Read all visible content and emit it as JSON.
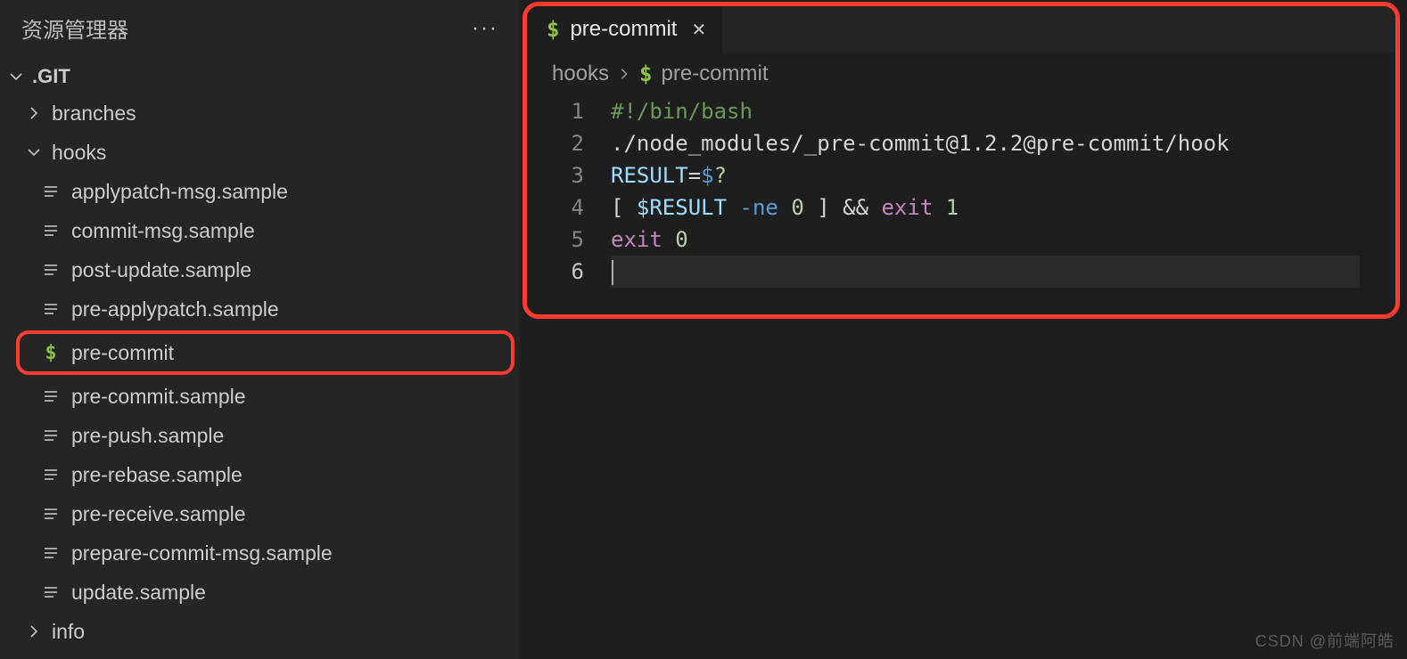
{
  "explorer": {
    "title": "资源管理器",
    "root": ".GIT",
    "folders": [
      {
        "name": "branches",
        "expanded": false
      },
      {
        "name": "hooks",
        "expanded": true
      },
      {
        "name": "info",
        "expanded": false
      }
    ],
    "hooks_files": [
      {
        "name": "applypatch-msg.sample",
        "icon": "lines",
        "highlight": false
      },
      {
        "name": "commit-msg.sample",
        "icon": "lines",
        "highlight": false
      },
      {
        "name": "post-update.sample",
        "icon": "lines",
        "highlight": false
      },
      {
        "name": "pre-applypatch.sample",
        "icon": "lines",
        "highlight": false
      },
      {
        "name": "pre-commit",
        "icon": "dollar",
        "highlight": true
      },
      {
        "name": "pre-commit.sample",
        "icon": "lines",
        "highlight": false
      },
      {
        "name": "pre-push.sample",
        "icon": "lines",
        "highlight": false
      },
      {
        "name": "pre-rebase.sample",
        "icon": "lines",
        "highlight": false
      },
      {
        "name": "pre-receive.sample",
        "icon": "lines",
        "highlight": false
      },
      {
        "name": "prepare-commit-msg.sample",
        "icon": "lines",
        "highlight": false
      },
      {
        "name": "update.sample",
        "icon": "lines",
        "highlight": false
      }
    ]
  },
  "editor": {
    "tab": {
      "title": "pre-commit"
    },
    "breadcrumb": {
      "folder": "hooks",
      "file": "pre-commit"
    },
    "lines": [
      {
        "n": "1",
        "tokens": [
          {
            "t": "#!/bin/bash",
            "c": "tk-comment"
          }
        ]
      },
      {
        "n": "2",
        "tokens": [
          {
            "t": "./node_modules/_pre-commit@1.2.2@pre-commit/hook",
            "c": "tk-string"
          }
        ]
      },
      {
        "n": "3",
        "tokens": [
          {
            "t": "RESULT",
            "c": "tk-var"
          },
          {
            "t": "=",
            "c": "tk-op"
          },
          {
            "t": "$",
            "c": "tk-dollar"
          },
          {
            "t": "?",
            "c": "tk-qm"
          }
        ]
      },
      {
        "n": "4",
        "tokens": [
          {
            "t": "[ ",
            "c": "tk-punc"
          },
          {
            "t": "$RESULT",
            "c": "tk-var"
          },
          {
            "t": " ",
            "c": "tk-op"
          },
          {
            "t": "-ne",
            "c": "tk-keyword"
          },
          {
            "t": " ",
            "c": "tk-op"
          },
          {
            "t": "0",
            "c": "tk-num"
          },
          {
            "t": " ]",
            "c": "tk-punc"
          },
          {
            "t": " && ",
            "c": "tk-op"
          },
          {
            "t": "exit",
            "c": "tk-control"
          },
          {
            "t": " ",
            "c": "tk-op"
          },
          {
            "t": "1",
            "c": "tk-num"
          }
        ]
      },
      {
        "n": "5",
        "tokens": [
          {
            "t": "exit",
            "c": "tk-control"
          },
          {
            "t": " ",
            "c": "tk-op"
          },
          {
            "t": "0",
            "c": "tk-num"
          }
        ]
      },
      {
        "n": "6",
        "tokens": [],
        "current": true
      }
    ]
  },
  "watermark": "CSDN @前端阿皓"
}
